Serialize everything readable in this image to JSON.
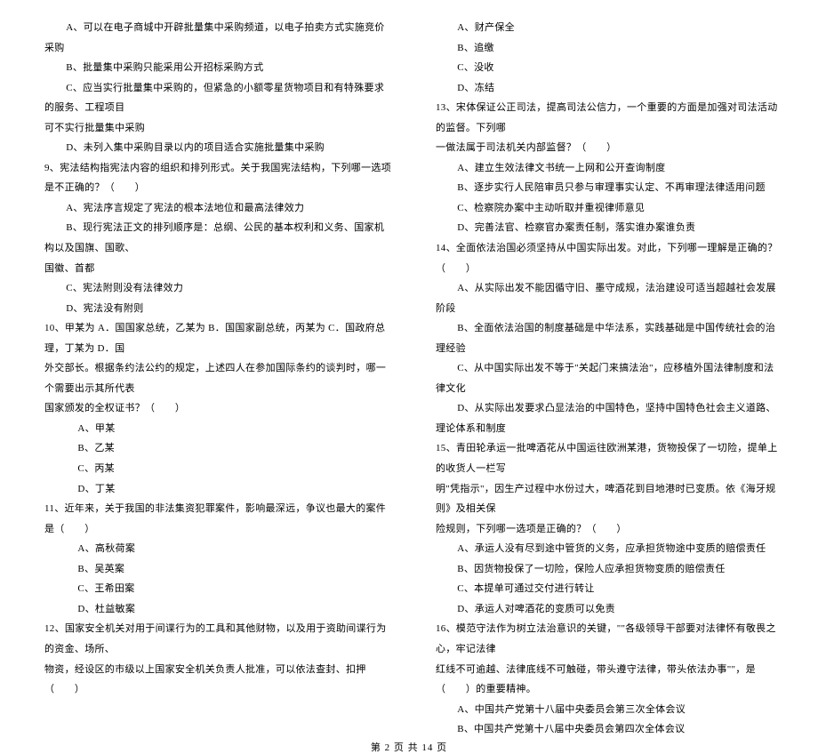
{
  "left": {
    "l01": "A、可以在电子商城中开辟批量集中采购频道，以电子拍卖方式实施竞价采购",
    "l02": "B、批量集中采购只能采用公开招标采购方式",
    "l03": "C、应当实行批量集中采购的，但紧急的小额零星货物项目和有特殊要求的服务、工程项目",
    "l04": "可不实行批量集中采购",
    "l05": "D、未列入集中采购目录以内的项目适合实施批量集中采购",
    "l06": "9、宪法结构指宪法内容的组织和排列形式。关于我国宪法结构，下列哪一选项是不正确的？（　　）",
    "l07": "A、宪法序言规定了宪法的根本法地位和最高法律效力",
    "l08": "B、现行宪法正文的排列顺序是：总纲、公民的基本权利和义务、国家机构以及国旗、国歌、",
    "l09": "国徽、首都",
    "l10": "C、宪法附则没有法律效力",
    "l11": "D、宪法没有附则",
    "l12": "10、甲某为 A．国国家总统，乙某为 B．国国家副总统，丙某为 C．国政府总理，丁某为 D．国",
    "l13": "外交部长。根据条约法公约的规定，上述四人在参加国际条约的谈判时，哪一个需要出示其所代表",
    "l14": "国家颁发的全权证书？（　　）",
    "l15": "A、甲某",
    "l16": "B、乙某",
    "l17": "C、丙某",
    "l18": "D、丁某",
    "l19": "11、近年来，关于我国的非法集资犯罪案件，影响最深远，争议也最大的案件是（　　）",
    "l20": "A、高秋荷案",
    "l21": "B、吴英案",
    "l22": "C、王希田案",
    "l23": "D、杜益敏案",
    "l24": "12、国家安全机关对用于间谍行为的工具和其他财物，以及用于资助间谍行为的资金、场所、",
    "l25": "物资，经设区的市级以上国家安全机关负责人批准，可以依法查封、扣押（　　）"
  },
  "right": {
    "r01": "A、财产保全",
    "r02": "B、追缴",
    "r03": "C、没收",
    "r04": "D、冻结",
    "r05": "13、宋体保证公正司法，提高司法公信力，一个重要的方面是加强对司法活动的监督。下列哪",
    "r06": "一做法属于司法机关内部监督？（　　）",
    "r07": "A、建立生效法律文书统一上网和公开查询制度",
    "r08": "B、逐步实行人民陪审员只参与审理事实认定、不再审理法律适用问题",
    "r09": "C、检察院办案中主动听取并重视律师意见",
    "r10": "D、完善法官、检察官办案责任制，落实谁办案谁负责",
    "r11": "14、全面依法治国必须坚持从中国实际出发。对此，下列哪一理解是正确的？（　　）",
    "r12": "A、从实际出发不能因循守旧、墨守成规，法治建设可适当超越社会发展阶段",
    "r13": "B、全面依法治国的制度基础是中华法系，实践基础是中国传统社会的治理经验",
    "r14": "C、从中国实际出发不等于\"关起门来搞法治\"，应移植外国法律制度和法律文化",
    "r15": "D、从实际出发要求凸显法治的中国特色，坚持中国特色社会主义道路、理论体系和制度",
    "r16": "15、青田轮承运一批啤酒花从中国运往欧洲某港，货物投保了一切险，提单上的收货人一栏写",
    "r17": "明\"凭指示\"，因生产过程中水份过大，啤酒花到目地港时已变质。依《海牙规则》及相关保",
    "r18": "险规则，下列哪一选项是正确的？（　　）",
    "r19": "A、承运人没有尽到途中管货的义务，应承担货物途中变质的赔偿责任",
    "r20": "B、因货物投保了一切险，保险人应承担货物变质的赔偿责任",
    "r21": "C、本提单可通过交付进行转让",
    "r22": "D、承运人对啤酒花的变质可以免责",
    "r23": "16、模范守法作为树立法治意识的关键，\"\"各级领导干部要对法律怀有敬畏之心，牢记法律",
    "r24": "红线不可逾越、法律底线不可触碰，带头遵守法律，带头依法办事\"\"，是（　　）的重要精神。",
    "r25": "A、中国共产党第十八届中央委员会第三次全体会议",
    "r26": "B、中国共产党第十八届中央委员会第四次全体会议"
  },
  "footer": "第 2 页 共 14 页"
}
